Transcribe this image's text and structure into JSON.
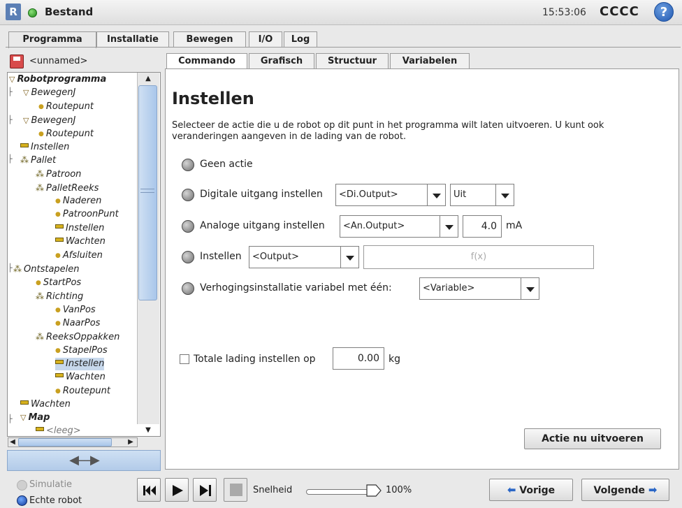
{
  "titlebar": {
    "app_title": "Bestand",
    "clock": "15:53:06",
    "robot_name": "CCCC",
    "help_symbol": "?"
  },
  "top_tabs": [
    {
      "label": "Programma",
      "active": true
    },
    {
      "label": "Installatie",
      "active": false
    },
    {
      "label": "Bewegen",
      "active": false
    },
    {
      "label": "I/O",
      "active": false
    },
    {
      "label": "Log",
      "active": false
    }
  ],
  "program": {
    "name": "<unnamed>"
  },
  "tree": [
    {
      "label": "Robotprogramma",
      "icon": "folder-icon",
      "bold": true
    },
    {
      "label": "BewegenJ",
      "icon": "folder-icon"
    },
    {
      "label": "Routepunt",
      "icon": "waypoint-icon"
    },
    {
      "label": "BewegenJ",
      "icon": "folder-icon"
    },
    {
      "label": "Routepunt",
      "icon": "waypoint-icon"
    },
    {
      "label": "Instellen",
      "icon": "set-icon"
    },
    {
      "label": "Pallet",
      "icon": "pallet-icon"
    },
    {
      "label": "Patroon",
      "icon": "pallet-icon"
    },
    {
      "label": "PalletReeks",
      "icon": "pallet-icon"
    },
    {
      "label": "Naderen",
      "icon": "waypoint-icon"
    },
    {
      "label": "PatroonPunt",
      "icon": "waypoint-icon"
    },
    {
      "label": "Instellen",
      "icon": "set-icon"
    },
    {
      "label": "Wachten",
      "icon": "set-icon"
    },
    {
      "label": "Afsluiten",
      "icon": "waypoint-icon"
    },
    {
      "label": "Ontstapelen",
      "icon": "pallet-icon"
    },
    {
      "label": "StartPos",
      "icon": "waypoint-icon"
    },
    {
      "label": "Richting",
      "icon": "pallet-icon"
    },
    {
      "label": "VanPos",
      "icon": "waypoint-icon"
    },
    {
      "label": "NaarPos",
      "icon": "waypoint-icon"
    },
    {
      "label": "ReeksOppakken",
      "icon": "pallet-icon"
    },
    {
      "label": "StapelPos",
      "icon": "waypoint-icon"
    },
    {
      "label": "Instellen",
      "icon": "set-icon",
      "selected": true
    },
    {
      "label": "Wachten",
      "icon": "set-icon"
    },
    {
      "label": "Routepunt",
      "icon": "waypoint-icon"
    },
    {
      "label": "Wachten",
      "icon": "set-icon"
    },
    {
      "label": "Map",
      "icon": "folder-icon",
      "bold": true
    },
    {
      "label": "<leeg>",
      "icon": "set-icon"
    }
  ],
  "sub_tabs": [
    {
      "label": "Commando",
      "active": true
    },
    {
      "label": "Grafisch",
      "active": false
    },
    {
      "label": "Structuur",
      "active": false
    },
    {
      "label": "Variabelen",
      "active": false
    }
  ],
  "content": {
    "title": "Instellen",
    "description": "Selecteer de actie die u de robot op dit punt in het programma wilt laten uitvoeren. U kunt ook veranderingen aangeven in de lading van de robot.",
    "options": {
      "no_action": "Geen actie",
      "digital": {
        "label": "Digitale uitgang instellen",
        "output": "<Di.Output>",
        "value": "Uit"
      },
      "analog": {
        "label": "Analoge uitgang instellen",
        "output": "<An.Output>",
        "value": "4.0",
        "unit": "mA"
      },
      "set": {
        "label": "Instellen",
        "output": "<Output>",
        "expression_placeholder": "f(x)"
      },
      "increment": {
        "label": "Verhogingsinstallatie variabel met één:",
        "variable": "<Variable>"
      }
    },
    "payload": {
      "label": "Totale lading instellen op",
      "value": "0.00",
      "unit": "kg",
      "checked": false
    },
    "execute_label": "Actie nu uitvoeren"
  },
  "bottom": {
    "simulation_label": "Simulatie",
    "real_robot_label": "Echte robot",
    "speed_label": "Snelheid",
    "speed_value": "100%",
    "speed_fraction": 1.0,
    "prev_label": "Vorige",
    "next_label": "Volgende"
  }
}
